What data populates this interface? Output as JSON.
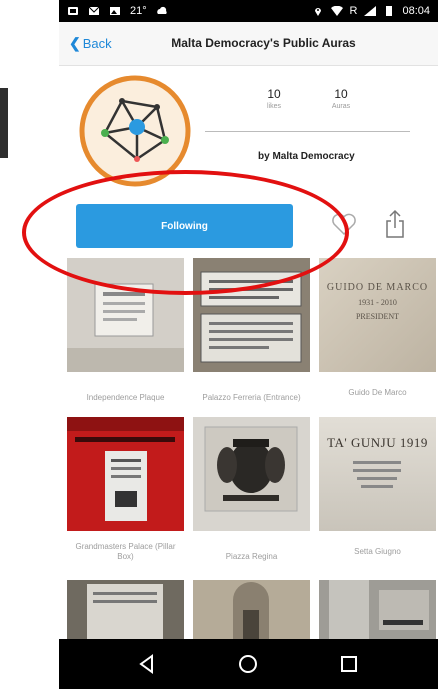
{
  "status_bar": {
    "temperature": "21°",
    "time": "08:04",
    "network": "R"
  },
  "nav": {
    "back_label": "Back",
    "title": "Malta Democracy's Public Auras"
  },
  "profile": {
    "likes_count": "10",
    "likes_label": "likes",
    "auras_count": "10",
    "auras_label": "Auras",
    "byline": "by Malta Democracy"
  },
  "actions": {
    "following_label": "Following"
  },
  "auras": [
    {
      "caption": "Independence Plaque"
    },
    {
      "caption": "Palazzo Ferreria (Entrance)"
    },
    {
      "caption": "Guido De Marco"
    },
    {
      "caption": "Grandmasters Palace (Pillar Box)"
    },
    {
      "caption": "Piazza Regina"
    },
    {
      "caption": "Setta Giugno"
    }
  ],
  "thumb_text": {
    "guido_line1": "GUIDO DE MARCO",
    "guido_line2": "1931 - 2010",
    "guido_line3": "PRESIDENT",
    "setta_line1": "TA' GUNJU 1919"
  },
  "colors": {
    "accent": "#2b9ae0",
    "link": "#1e88d8",
    "annotation": "#e21010",
    "avatar_ring": "#e68a2e"
  },
  "icons": {
    "back": "chevron-left-icon",
    "heart": "heart-icon",
    "share": "share-icon",
    "nav_back": "triangle-back-icon",
    "nav_home": "circle-home-icon",
    "nav_recents": "square-recents-icon"
  }
}
